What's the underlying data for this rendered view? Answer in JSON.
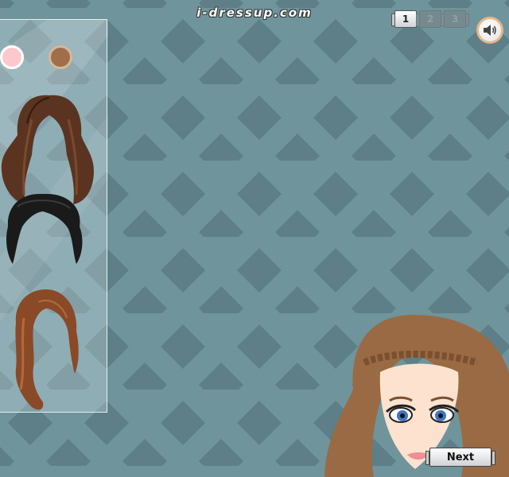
{
  "site": {
    "logo_text": "i-dressup.com"
  },
  "page_tabs": [
    {
      "label": "1",
      "active": true
    },
    {
      "label": "2",
      "active": false
    },
    {
      "label": "3",
      "active": false
    }
  ],
  "sound": {
    "icon": "speaker-icon"
  },
  "panel": {
    "color_swatches": [
      {
        "name": "pink",
        "color": "#ffc8cc"
      },
      {
        "name": "brown",
        "color": "#a06e4a"
      }
    ],
    "hair_options": [
      {
        "name": "long-brown-hair",
        "color": "#5a3420"
      },
      {
        "name": "short-black-hair",
        "color": "#1a1a1a"
      },
      {
        "name": "wavy-auburn-hair",
        "color": "#8a4a28"
      }
    ]
  },
  "next_button": {
    "label": "Next"
  },
  "colors": {
    "background": "#6f949c",
    "diamond": "#5e7f87",
    "hair_main": "#9a6a44"
  }
}
